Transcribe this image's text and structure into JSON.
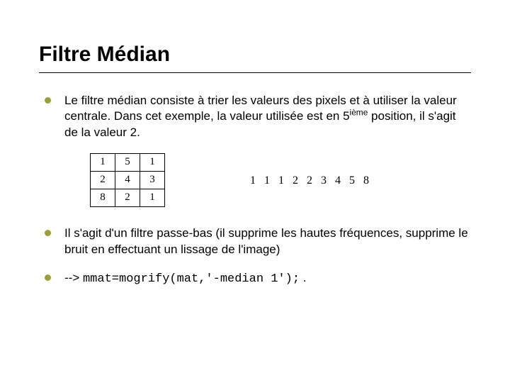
{
  "title": "Filtre Médian",
  "bullets": {
    "b1_part1": "Le filtre médian consiste à trier les valeurs des pixels et à utiliser la valeur centrale. Dans cet exemple, la valeur utilisée est en 5",
    "b1_sup": "ième",
    "b1_part2": " position, il s'agit de la valeur 2.",
    "b2": "Il s'agit d'un filtre passe-bas (il supprime les hautes fréquences, supprime le bruit en effectuant un lissage de l'image)",
    "b3_prefix": "--> ",
    "b3_code": "mmat=mogrify(mat,'-median 1');",
    "b3_suffix": " ."
  },
  "grid": {
    "r0c0": "1",
    "r0c1": "5",
    "r0c2": "1",
    "r1c0": "2",
    "r1c1": "4",
    "r1c2": "3",
    "r2c0": "8",
    "r2c1": "2",
    "r2c2": "1"
  },
  "sorted_values": "1 1 1 2 2 3 4 5 8"
}
